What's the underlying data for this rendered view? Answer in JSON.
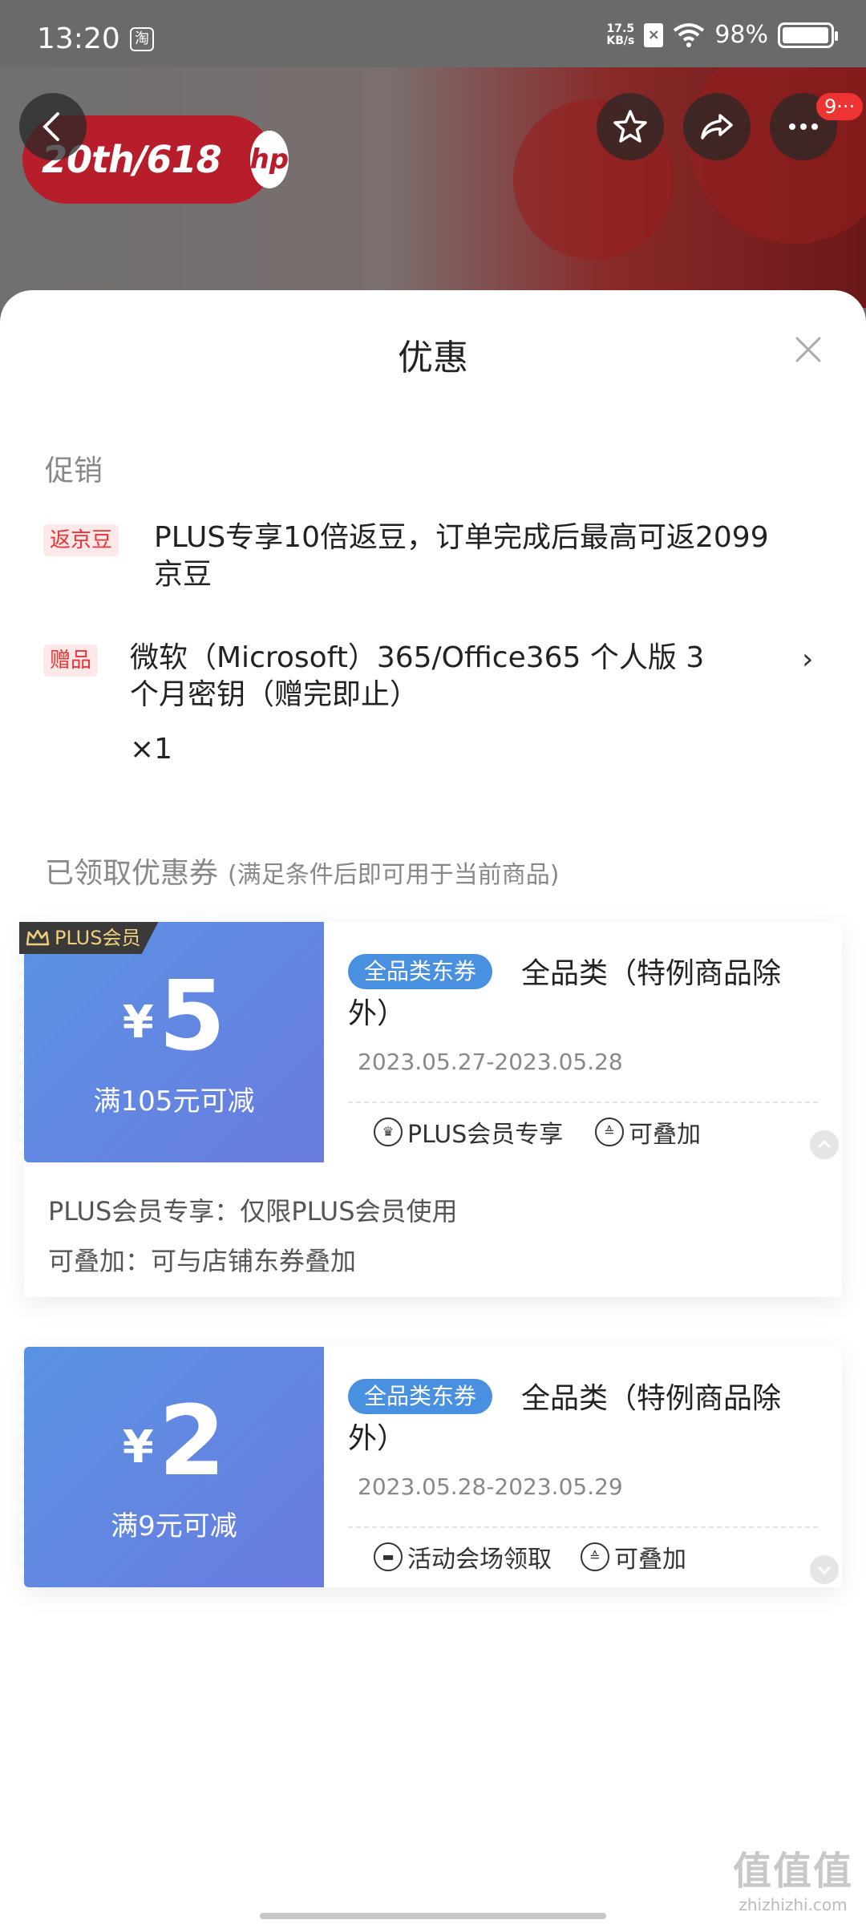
{
  "status_bar": {
    "time": "13:20",
    "app_icon": "淘",
    "net_speed_value": "17.5",
    "net_speed_unit": "KB/s",
    "battery": "98%",
    "battery_level": 0.98
  },
  "product_header": {
    "badge_text": "20th/618",
    "brand": "hp",
    "more_count": "9···"
  },
  "sheet": {
    "title": "优惠",
    "promotions_label": "促销",
    "promotions": [
      {
        "tag": "返京豆",
        "text_line1": "PLUS专享10倍返豆，订单完成后最高可返2099",
        "text_line2": "京豆"
      },
      {
        "tag": "赠品",
        "text_line1": "微软（Microsoft）365/Office365 个人版 3",
        "text_line2": "个月密钥（赠完即止）",
        "qty": "×1"
      }
    ],
    "coupons_label": "已领取优惠券",
    "coupons_hint": "(满足条件后即可用于当前商品)",
    "coupons": [
      {
        "ribbon": "PLUS会员",
        "currency": "¥",
        "amount": "5",
        "condition": "满105元可减",
        "category_pill": "全品类东券",
        "title": "全品类（特例商品除外）",
        "date": "2023.05.27-2023.05.28",
        "feature1": "PLUS会员专享",
        "feature2": "可叠加",
        "detail_line1": "PLUS会员专享：仅限PLUS会员使用",
        "detail_line2": "可叠加：可与店铺东券叠加"
      },
      {
        "currency": "¥",
        "amount": "2",
        "condition": "满9元可减",
        "category_pill": "全品类东券",
        "title": "全品类（特例商品除外）",
        "date": "2023.05.28-2023.05.29",
        "feature1": "活动会场领取",
        "feature2": "可叠加"
      }
    ]
  },
  "watermark": {
    "logo": "值值值",
    "url": "zhizhizhi.com"
  }
}
